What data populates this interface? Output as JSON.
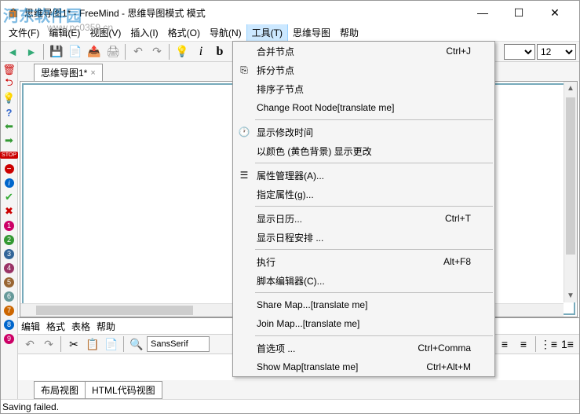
{
  "titlebar": {
    "title": "思维导图1* - FreeMind - 思维导图模式 模式"
  },
  "watermark": {
    "text1": "河东软件园",
    "text2": "www.pc0359.cn"
  },
  "menubar": {
    "items": [
      {
        "label": "文件(F)"
      },
      {
        "label": "编辑(E)"
      },
      {
        "label": "视图(V)"
      },
      {
        "label": "插入(I)"
      },
      {
        "label": "格式(O)"
      },
      {
        "label": "导航(N)"
      },
      {
        "label": "工具(T)"
      },
      {
        "label": "思维导图"
      },
      {
        "label": "帮助"
      }
    ]
  },
  "toolbar": {
    "italic": "i",
    "bold": "b",
    "fontsize_value": "12"
  },
  "tab": {
    "name": "思维导图1*"
  },
  "tools_menu": {
    "items": [
      {
        "icon": "",
        "label": "合并节点",
        "shortcut": "Ctrl+J"
      },
      {
        "icon": "⎘",
        "label": "拆分节点",
        "shortcut": ""
      },
      {
        "icon": "",
        "label": "排序子节点",
        "shortcut": ""
      },
      {
        "icon": "",
        "label": "Change Root Node[translate me]",
        "shortcut": ""
      },
      {
        "sep": true
      },
      {
        "icon": "🕐",
        "label": "显示修改时间",
        "shortcut": ""
      },
      {
        "icon": "",
        "label": "以颜色 (黄色背景) 显示更改",
        "shortcut": ""
      },
      {
        "sep": true
      },
      {
        "icon": "☰",
        "label": "属性管理器(A)...",
        "shortcut": ""
      },
      {
        "icon": "",
        "label": "指定属性(g)...",
        "shortcut": ""
      },
      {
        "sep": true
      },
      {
        "icon": "",
        "label": "显示日历...",
        "shortcut": "Ctrl+T"
      },
      {
        "icon": "",
        "label": "显示日程安排 ...",
        "shortcut": ""
      },
      {
        "sep": true
      },
      {
        "icon": "",
        "label": "执行",
        "shortcut": "Alt+F8"
      },
      {
        "icon": "",
        "label": "脚本编辑器(C)...",
        "shortcut": ""
      },
      {
        "sep": true
      },
      {
        "icon": "",
        "label": "Share Map...[translate me]",
        "shortcut": ""
      },
      {
        "icon": "",
        "label": "Join Map...[translate me]",
        "shortcut": ""
      },
      {
        "sep": true
      },
      {
        "icon": "",
        "label": "首选项 ...",
        "shortcut": "Ctrl+Comma"
      },
      {
        "icon": "",
        "label": "Show Map[translate me]",
        "shortcut": "Ctrl+Alt+M"
      }
    ]
  },
  "bottom_panel": {
    "menu": [
      "编辑",
      "格式",
      "表格",
      "帮助"
    ],
    "font": "SansSerif"
  },
  "bottom_tabs": {
    "t1": "布局视图",
    "t2": "HTML代码视图"
  },
  "status": {
    "text": "Saving failed."
  }
}
